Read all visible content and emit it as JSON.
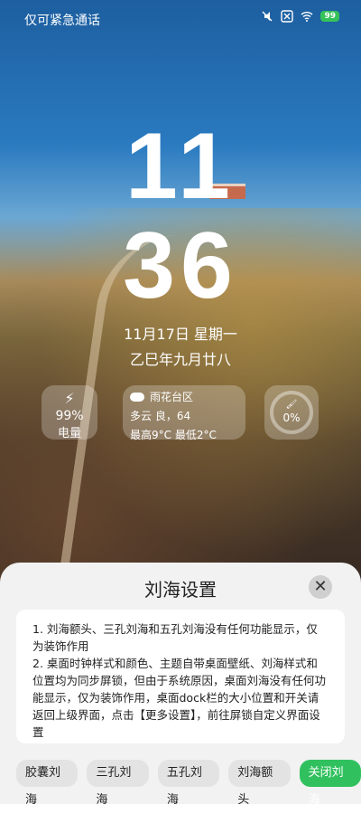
{
  "status_bar": {
    "carrier": "仅可紧急通话",
    "battery": "99"
  },
  "lock_screen": {
    "hour": "11",
    "minute": "36",
    "date_line": "11月17日 星期一",
    "lunar_line": "乙巳年九月廿八",
    "battery_widget": {
      "percent": "99%",
      "label": "电量"
    },
    "weather_widget": {
      "location": "雨花台区",
      "condition": "多云 良，64",
      "temps": "最高9°C  最低2°C"
    },
    "ring_widget": {
      "percent": "0%"
    }
  },
  "sheet": {
    "title": "刘海设置",
    "close_label": "✕",
    "note1": "1. 刘海额头、三孔刘海和五孔刘海没有任何功能显示，仅为装饰作用",
    "note2": "2. 桌面时钟样式和颜色、主题自带桌面壁纸、刘海样式和位置均为同步屏锁，但由于系统原因，桌面刘海没有任何功能显示，仅为装饰作用，桌面dock栏的大小位置和开关请返回上级界面，点击【更多设置】，前往屏锁自定义界面设置",
    "buttons": [
      "胶囊刘海",
      "三孔刘海",
      "五孔刘海",
      "刘海额头",
      "关闭刘海"
    ],
    "selected_button": "关闭刘海",
    "accent_color": "#30c15e"
  }
}
